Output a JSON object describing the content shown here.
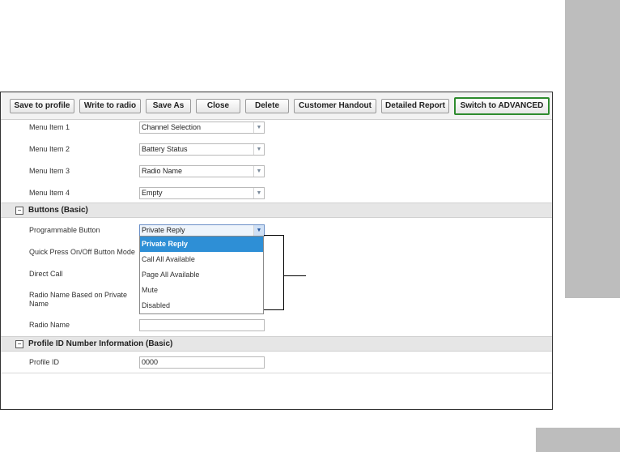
{
  "toolbar": {
    "buttons": [
      {
        "label": "Save to profile"
      },
      {
        "label": "Write to radio"
      },
      {
        "label": "Save As"
      },
      {
        "label": "Close"
      },
      {
        "label": "Delete"
      },
      {
        "label": "Customer Handout"
      },
      {
        "label": "Detailed Report"
      },
      {
        "label": "Switch to ADVANCED"
      }
    ]
  },
  "menu_items": [
    {
      "label": "Menu Item 1",
      "value": "Channel Selection"
    },
    {
      "label": "Menu Item 2",
      "value": "Battery Status"
    },
    {
      "label": "Menu Item 3",
      "value": "Radio Name"
    },
    {
      "label": "Menu Item 4",
      "value": "Empty"
    }
  ],
  "buttons_section": {
    "title": "Buttons (Basic)",
    "toggle": "−",
    "programmable_button": {
      "label": "Programmable Button",
      "value": "Private Reply"
    },
    "quick_press": {
      "label": "Quick Press On/Off Button Mode"
    },
    "direct_call": {
      "label": "Direct Call"
    },
    "radio_name_private": {
      "label": "Radio Name Based on Private Name"
    },
    "radio_name": {
      "label": "Radio Name",
      "value": ""
    },
    "dropdown_options": [
      "Private Reply",
      "Call All Available",
      "Page All Available",
      "Mute",
      "Disabled"
    ],
    "dropdown_selected": "Private Reply"
  },
  "profile_section": {
    "title": "Profile ID Number Information (Basic)",
    "toggle": "−",
    "profile_id": {
      "label": "Profile ID",
      "value": "0000"
    }
  },
  "icons": {
    "dropdown_arrow": "▼"
  },
  "colors": {
    "accent_green": "#2e8b2e",
    "selected_blue": "#2e8fd6",
    "side_tab": "#bdbdbd"
  }
}
